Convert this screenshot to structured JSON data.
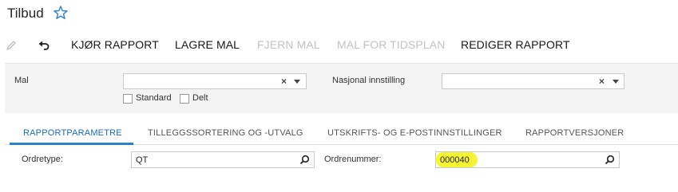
{
  "header": {
    "title": "Tilbud",
    "favorite_icon": "star-outline-icon"
  },
  "toolbar": {
    "edit_icon": "pencil-icon",
    "undo_icon": "undo-icon",
    "run_report": "KJØR RAPPORT",
    "save_template": "LAGRE MAL",
    "remove_template": "FJERN MAL",
    "schedule_template": "MAL FOR TIDSPLAN",
    "edit_report": "REDIGER RAPPORT"
  },
  "filters": {
    "template_label": "Mal",
    "template_value": "",
    "standard_label": "Standard",
    "shared_label": "Delt",
    "locale_label": "Nasjonal innstilling",
    "locale_value": "",
    "clear_glyph": "×"
  },
  "tabs": [
    {
      "label": "RAPPORTPARAMETRE",
      "active": true
    },
    {
      "label": "TILLEGGSSORTERING OG -UTVALG",
      "active": false
    },
    {
      "label": "UTSKRIFTS- OG E-POSTINNSTILLINGER",
      "active": false
    },
    {
      "label": "RAPPORTVERSJONER",
      "active": false
    }
  ],
  "parameters": {
    "order_type_label": "Ordretype:",
    "order_type_value": "QT",
    "order_number_label": "Ordrenummer:",
    "order_number_value": "000040"
  },
  "colors": {
    "accent": "#2d7fd1",
    "highlight": "#f5f532",
    "disabled": "#c3c3c3"
  }
}
